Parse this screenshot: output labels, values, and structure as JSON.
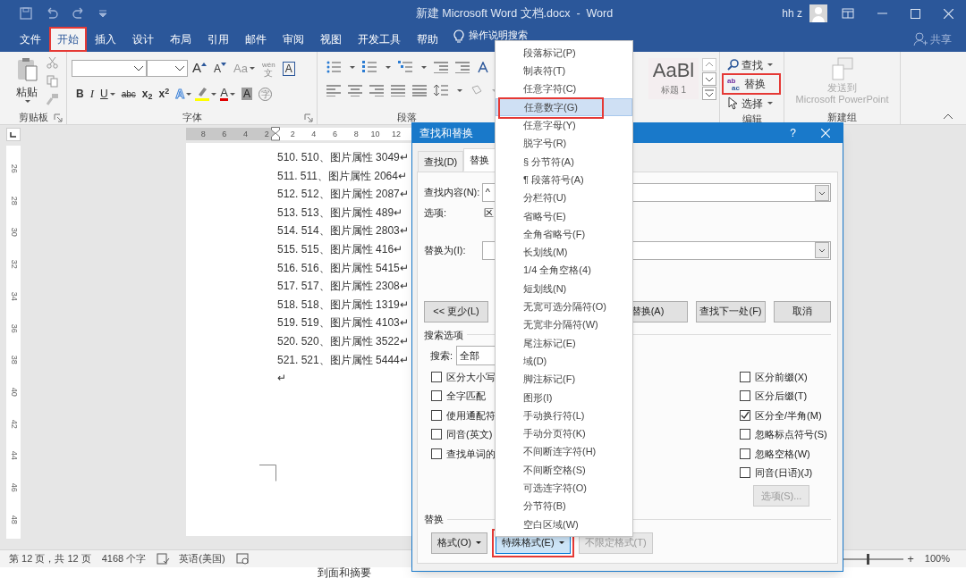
{
  "title_bar": {
    "title": "新建 Microsoft Word 文档.docx  -  Word",
    "user": "hh z"
  },
  "ribbon_tabs": [
    {
      "label": "文件",
      "selected": false
    },
    {
      "label": "开始",
      "selected": true,
      "annotated": true
    },
    {
      "label": "插入",
      "selected": false
    },
    {
      "label": "设计",
      "selected": false
    },
    {
      "label": "布局",
      "selected": false
    },
    {
      "label": "引用",
      "selected": false
    },
    {
      "label": "邮件",
      "selected": false
    },
    {
      "label": "审阅",
      "selected": false
    },
    {
      "label": "视图",
      "selected": false
    },
    {
      "label": "开发工具",
      "selected": false
    },
    {
      "label": "帮助",
      "selected": false
    }
  ],
  "tell_me": "操作说明搜索",
  "share": "共享",
  "ribbon": {
    "paste": "粘贴",
    "font_row1": [
      {
        "kind": "grow",
        "text": "A"
      },
      {
        "kind": "shrink",
        "text": "A"
      },
      {
        "kind": "case",
        "text": "Aa",
        "caret": true
      },
      {
        "kind": "phonetic",
        "text": "文",
        "ruby": "wén"
      },
      {
        "kind": "boxed",
        "text": "A"
      }
    ],
    "font_row2": [
      {
        "kind": "bold",
        "text": "B"
      },
      {
        "kind": "italic",
        "text": "I"
      },
      {
        "kind": "underline",
        "text": "U",
        "caret": true
      },
      {
        "kind": "strike",
        "text": "abc"
      },
      {
        "kind": "plain",
        "text": "x$_{2}$"
      },
      {
        "kind": "plain",
        "text": "x$^{2}$"
      },
      {
        "kind": "effect",
        "text": "A",
        "caret": true
      },
      {
        "kind": "highlight",
        "caret": true
      },
      {
        "kind": "color",
        "text": "A",
        "caret": true
      },
      {
        "kind": "shaded",
        "text": "A"
      },
      {
        "kind": "circled",
        "text": "字"
      }
    ],
    "style_preview": "AaBl",
    "style_name": "标题 1",
    "find": "查找",
    "replace": "替换",
    "replace_icon": [
      "ab",
      "ac"
    ],
    "select": "选择",
    "send_to": "发送到",
    "send_to_app": "Microsoft PowerPoint",
    "groups": [
      "剪贴板",
      "字体",
      "段落",
      "编辑",
      "新建组"
    ]
  },
  "ruler": {
    "left_marks": [
      "8",
      "6",
      "4",
      "2"
    ],
    "right_marks": [
      "2",
      "4",
      "6",
      "8",
      "10",
      "12"
    ]
  },
  "vertical_ruler": [
    "26",
    "28",
    "30",
    "32",
    "34",
    "36",
    "38",
    "40",
    "42",
    "44",
    "46",
    "48"
  ],
  "document": {
    "lines": [
      "510. 510、图片属性 3049↵",
      "511. 511、图片属性 2064↵",
      "512. 512、图片属性 2087↵",
      "513. 513、图片属性 489↵",
      "514. 514、图片属性 2803↵",
      "515. 515、图片属性 416↵",
      "516. 516、图片属性 5415↵",
      "517. 517、图片属性 2308↵",
      "518. 518、图片属性 1319↵",
      "519. 519、图片属性 4103↵",
      "520. 520、图片属性 3522↵",
      "521. 521、图片属性 5444↵",
      "↵"
    ]
  },
  "status_bar": {
    "page": "第 12 页，共 12 页",
    "words": "4168 个字",
    "language": "英语(美国)",
    "zoom_in": "+",
    "zoom": "100%",
    "zoom_slider": {
      "level": 0.5
    }
  },
  "below_window": "到面和摘要",
  "dialog": {
    "title": "查找和替换",
    "help": "?",
    "tabs": [
      {
        "label": "查找(D)",
        "selected": false
      },
      {
        "label": "替换",
        "selected": true
      }
    ],
    "find_label": "查找内容(N):",
    "find_value": "^",
    "options_label": "选项:",
    "options_value": "区",
    "replace_label": "替换为(I):",
    "less_button": "<< 更少(L)",
    "replace_all_button": "替换(A)",
    "find_next_button": "查找下一处(F)",
    "cancel_button": "取消",
    "search_options": "搜索选项",
    "search_label": "搜索:",
    "search_value": "全部",
    "left_checks": [
      {
        "label": "区分大小写",
        "checked": false
      },
      {
        "label": "全字匹配",
        "checked": false
      },
      {
        "label": "使用通配符",
        "checked": false
      },
      {
        "label": "同音(英文)",
        "checked": false
      },
      {
        "label": "查找单词的",
        "checked": false
      }
    ],
    "right_checks": [
      {
        "label": "区分前缀(X)",
        "checked": false
      },
      {
        "label": "区分后缀(T)",
        "checked": false
      },
      {
        "label": "区分全/半角(M)",
        "checked": true
      },
      {
        "label": "忽略标点符号(S)",
        "checked": false
      },
      {
        "label": "忽略空格(W)",
        "checked": false
      },
      {
        "label": "同音(日语)(J)",
        "checked": false
      }
    ],
    "options_button": "选项(S)...",
    "replace_section": "替换",
    "bottom_buttons": [
      {
        "label": "格式(O)",
        "caret": true,
        "disabled": false,
        "pressed": false
      },
      {
        "label": "特殊格式(E)",
        "caret": true,
        "disabled": false,
        "pressed": true,
        "annotated": true
      },
      {
        "label": "不限定格式(T)",
        "disabled": true,
        "pressed": false
      }
    ]
  },
  "menu": {
    "items": [
      {
        "label": "段落标记(P)",
        "selected": false
      },
      {
        "label": "制表符(T)",
        "selected": false
      },
      {
        "label": "任意字符(C)",
        "selected": false
      },
      {
        "label": "任意数字(G)",
        "selected": true,
        "annotated": true
      },
      {
        "label": "任意字母(Y)",
        "selected": false
      },
      {
        "label": "脱字号(R)",
        "selected": false
      },
      {
        "label": "§ 分节符(A)",
        "selected": false
      },
      {
        "label": "¶ 段落符号(A)",
        "selected": false
      },
      {
        "label": "分栏符(U)",
        "selected": false
      },
      {
        "label": "省略号(E)",
        "selected": false
      },
      {
        "label": "全角省略号(F)",
        "selected": false
      },
      {
        "label": "长划线(M)",
        "selected": false
      },
      {
        "label": "1/4 全角空格(4)",
        "selected": false
      },
      {
        "label": "短划线(N)",
        "selected": false
      },
      {
        "label": "无宽可选分隔符(O)",
        "selected": false
      },
      {
        "label": "无宽非分隔符(W)",
        "selected": false
      },
      {
        "label": "尾注标记(E)",
        "selected": false
      },
      {
        "label": "域(D)",
        "selected": false
      },
      {
        "label": "脚注标记(F)",
        "selected": false
      },
      {
        "label": "图形(I)",
        "selected": false
      },
      {
        "label": "手动换行符(L)",
        "selected": false
      },
      {
        "label": "手动分页符(K)",
        "selected": false
      },
      {
        "label": "不间断连字符(H)",
        "selected": false
      },
      {
        "label": "不间断空格(S)",
        "selected": false
      },
      {
        "label": "可选连字符(O)",
        "selected": false
      },
      {
        "label": "分节符(B)",
        "selected": false
      },
      {
        "label": "空白区域(W)",
        "selected": false
      }
    ]
  }
}
